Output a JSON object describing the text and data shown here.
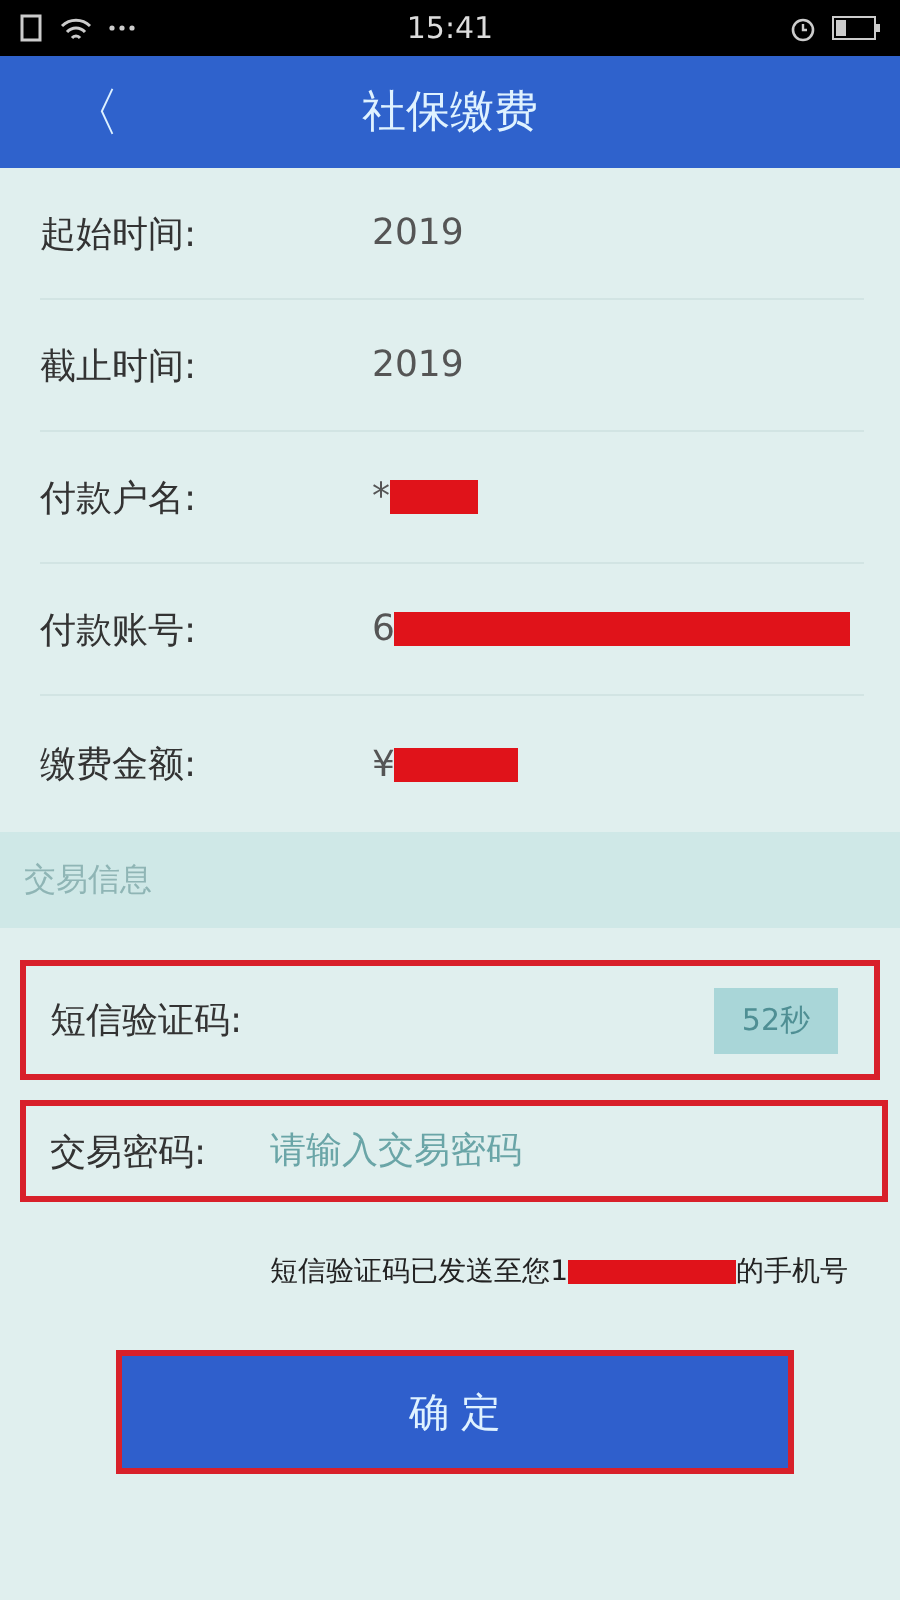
{
  "status_bar": {
    "time": "15:41"
  },
  "header": {
    "title": "社保缴费",
    "back_icon": "〈"
  },
  "details": [
    {
      "label": "起始时间:",
      "value": "2019",
      "redacted": false
    },
    {
      "label": "截止时间:",
      "value": "2019",
      "redacted": false
    },
    {
      "label": "付款户名:",
      "value": "*",
      "redacted": true
    },
    {
      "label": "付款账号:",
      "value": "6",
      "redacted": true
    },
    {
      "label": "缴费金额:",
      "value": "¥",
      "redacted": true
    }
  ],
  "section_title": "交易信息",
  "sms_code": {
    "label": "短信验证码:",
    "countdown": "52秒",
    "highlighted": true
  },
  "password": {
    "label": "交易密码:",
    "placeholder": "请输入交易密码",
    "highlighted": true
  },
  "sms_notice": {
    "before": "短信验证码已发送至您1",
    "after": "的手机号",
    "redacted": true
  },
  "confirm_button": {
    "label": "确 定",
    "highlighted": true
  }
}
